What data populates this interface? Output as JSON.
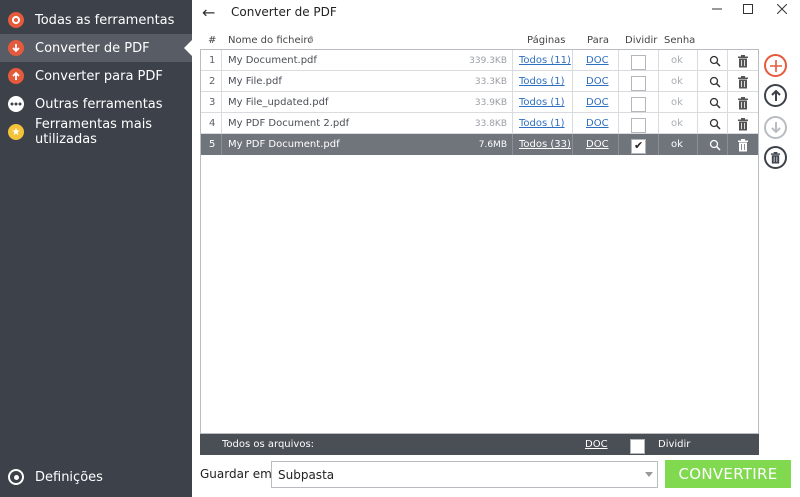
{
  "sidebar": {
    "items": [
      {
        "label": "Todas as ferramentas",
        "icon": "target-icon"
      },
      {
        "label": "Converter de PDF",
        "icon": "arrow-down-circle-icon",
        "active": true
      },
      {
        "label": "Converter para PDF",
        "icon": "arrow-up-circle-icon"
      },
      {
        "label": "Outras ferramentas",
        "icon": "more-dots-icon"
      },
      {
        "label": "Ferramentas mais utilizadas",
        "icon": "star-icon"
      }
    ],
    "settings_label": "Definições"
  },
  "titlebar": {
    "title": "Converter de PDF",
    "back_glyph": "←",
    "minimize_glyph": "—",
    "maximize_glyph": "☐",
    "close_glyph": "✕"
  },
  "table": {
    "headers": {
      "num": "#",
      "name": "Nome do ficheiro",
      "sort_glyph": "⇕",
      "pages": "Páginas",
      "to": "Para",
      "split": "Dividir",
      "password": "Senha"
    },
    "rows": [
      {
        "num": "1",
        "name": "My Document.pdf",
        "size": "339.3KB",
        "pages": "Todos (11)",
        "to": "DOC",
        "split": false,
        "password": "ok"
      },
      {
        "num": "2",
        "name": "My File.pdf",
        "size": "33.3KB",
        "pages": "Todos (1)",
        "to": "DOC",
        "split": false,
        "password": "ok"
      },
      {
        "num": "3",
        "name": "My File_updated.pdf",
        "size": "33.9KB",
        "pages": "Todos (1)",
        "to": "DOC",
        "split": false,
        "password": "ok"
      },
      {
        "num": "4",
        "name": "My PDF Document 2.pdf",
        "size": "33.8KB",
        "pages": "Todos (1)",
        "to": "DOC",
        "split": false,
        "password": "ok"
      },
      {
        "num": "5",
        "name": "My PDF Document.pdf",
        "size": "7.6MB",
        "pages": "Todos (33)",
        "to": "DOC",
        "split": true,
        "password": "ok",
        "selected": true
      }
    ],
    "footer": {
      "all_files_label": "Todos os arquivos:",
      "to": "DOC",
      "split_label": "Dividir"
    }
  },
  "side_buttons": {
    "add_glyph": "+",
    "up_glyph": "↑",
    "down_glyph": "↓"
  },
  "bottom": {
    "save_label": "Guardar em:",
    "save_value": "Subpasta",
    "convert_label": "CONVERTIRE"
  },
  "colors": {
    "sidebar_bg": "#3c414a",
    "sidebar_active": "#575c65",
    "accent_red": "#e55a3c",
    "convert_green": "#80d94f",
    "link_blue": "#2f6fbf",
    "selected_row": "#70747b"
  }
}
